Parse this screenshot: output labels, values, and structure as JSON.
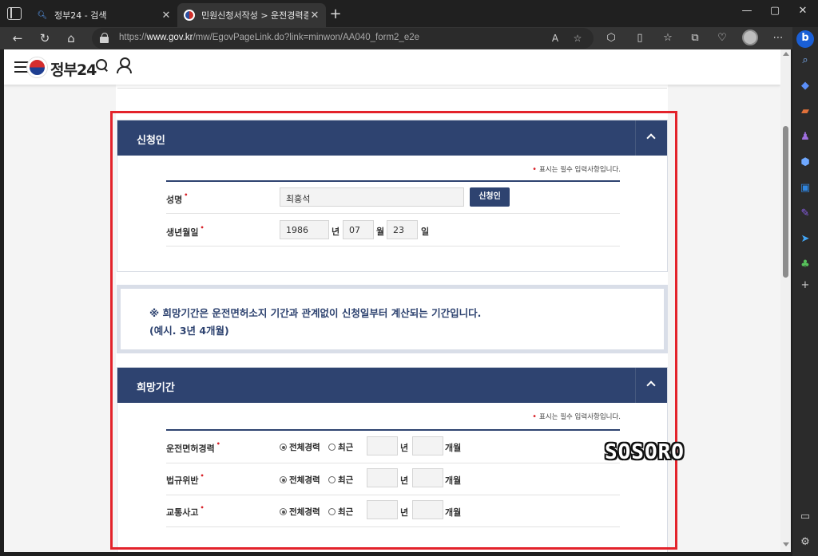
{
  "browser": {
    "tabs": [
      {
        "title": "정부24 - 검색",
        "active": false
      },
      {
        "title": "민원신청서작성 > 운전경력증명",
        "active": true
      }
    ],
    "url_prefix": "https://",
    "url_domain": "www.gov.kr",
    "url_path": "/mw/EgovPageLink.do?link=minwon/AA040_form2_e2e",
    "window_controls": {
      "minimize": "—",
      "maximize": "▢",
      "close": "✕"
    }
  },
  "site": {
    "logo_text": "정부24"
  },
  "applicant_section": {
    "title": "신청인",
    "required_note": "표시는 필수 입력사항입니다.",
    "name_label": "성명",
    "name_value": "최홍석",
    "name_button": "신청인",
    "birth_label": "생년월일",
    "birth_year": "1986",
    "year_unit": "년",
    "birth_month": "07",
    "month_unit": "월",
    "birth_day": "23",
    "day_unit": "일"
  },
  "notice": {
    "line1": "※ 희망기간은 운전면허소지 기간과 관계없이 신청일부터 계산되는 기간입니다.",
    "line2": "(예시. 3년 4개월)"
  },
  "period_section": {
    "title": "희망기간",
    "required_note": "표시는 필수 입력사항입니다.",
    "rows": [
      {
        "label": "운전면허경력",
        "option_all": "전체경력",
        "option_recent": "최근",
        "year_unit": "년",
        "month_unit": "개월"
      },
      {
        "label": "법규위반",
        "option_all": "전체경력",
        "option_recent": "최근",
        "year_unit": "년",
        "month_unit": "개월"
      },
      {
        "label": "교통사고",
        "option_all": "전체경력",
        "option_recent": "최근",
        "year_unit": "년",
        "month_unit": "개월"
      }
    ]
  },
  "watermark": "SOSORO",
  "colors": {
    "navy": "#2e4370",
    "highlight_red": "#e3232b",
    "required_red": "#d8232a"
  }
}
